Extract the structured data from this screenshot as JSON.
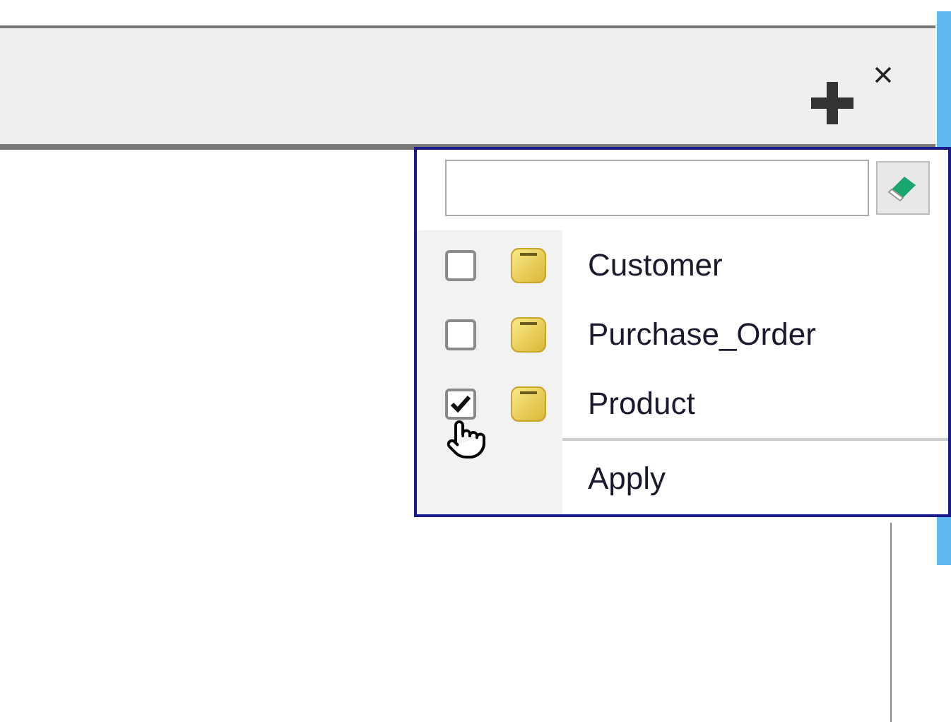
{
  "items": [
    {
      "label": "Customer",
      "checked": false
    },
    {
      "label": "Purchase_Order",
      "checked": false
    },
    {
      "label": "Product",
      "checked": true
    }
  ],
  "apply": {
    "label": "Apply"
  }
}
